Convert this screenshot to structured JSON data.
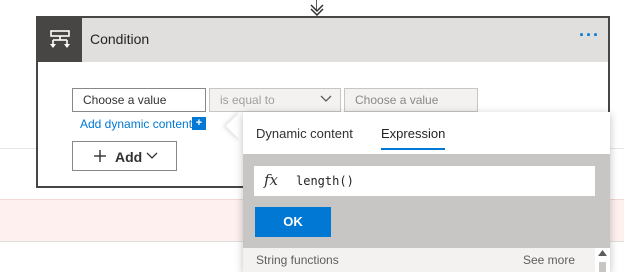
{
  "card": {
    "title": "Condition",
    "more_label": "···"
  },
  "condition_row": {
    "left_placeholder": "Choose a value",
    "operator": "is equal to",
    "right_placeholder": "Choose a value"
  },
  "dynamic_content_link": "Add dynamic content",
  "dynamic_content_plus": "+",
  "add_button": {
    "label": "Add"
  },
  "flyout": {
    "tabs": [
      {
        "label": "Dynamic content",
        "active": false
      },
      {
        "label": "Expression",
        "active": true
      }
    ],
    "fx_label": "fx",
    "expression_value": "length()",
    "ok_label": "OK",
    "section_title": "String functions",
    "see_more": "See more"
  },
  "colors": {
    "accent": "#0078d4",
    "card_header": "#e1dfdd",
    "card_icon_bg": "#484644",
    "error_band": "#fdf0ef"
  },
  "icons": {
    "condition": "condition-icon",
    "connector_arrow": "down-arrow-icon",
    "operator_dropdown": "chevron-down-icon",
    "add": "plus-icon",
    "add_dropdown": "chevron-down-icon",
    "scroll_up": "caret-up-icon"
  }
}
